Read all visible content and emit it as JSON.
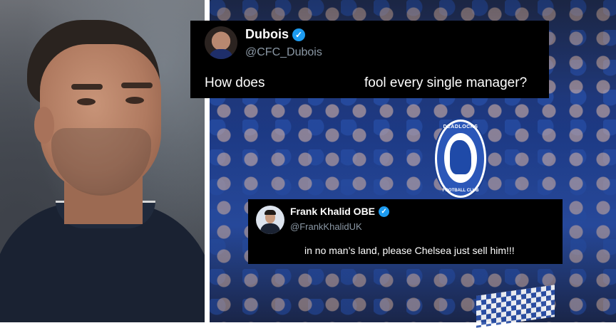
{
  "tweet_top": {
    "display_name": "Dubois",
    "verified_icon": "verified-badge-icon",
    "handle": "@CFC_Dubois",
    "text_part1": "How does",
    "text_part2": "fool every single manager?"
  },
  "tweet_bottom": {
    "display_name": "Frank Khalid OBE",
    "verified_icon": "verified-badge-icon",
    "handle": "@FrankKhalidUK",
    "text": "in no man’s land, please Chelsea just sell him!!!"
  },
  "badge": {
    "top_text": "DEADLOCKS",
    "bottom_text": "FOOTBALL CLUB"
  },
  "colors": {
    "tweet_background": "#000000",
    "handle_gray": "#8b98a5",
    "verified_blue": "#1d9bf0",
    "crowd_blue": "#2a4fa8"
  }
}
